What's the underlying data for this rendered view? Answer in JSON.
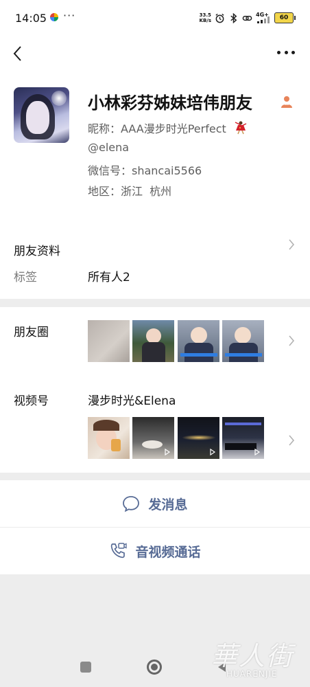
{
  "status_bar": {
    "time": "14:05",
    "more": "···",
    "speed_value": "33.5",
    "speed_unit": "KB/s",
    "network": "4G+",
    "battery": "60",
    "icons": [
      "pinwheel-icon",
      "alarm-icon",
      "bluetooth-icon",
      "link-icon",
      "signal-icon",
      "battery-icon"
    ]
  },
  "nav": {
    "back_icon": "chevron-left-icon",
    "more_icon": "more-dots-icon"
  },
  "profile": {
    "display_name": "小林彩芬姊妹培伟朋友",
    "nickname": "昵称：AAA漫步时光Perfect",
    "handle": "@elena",
    "wechat_id": "微信号：shancai5566",
    "region": "地区：浙江  杭州"
  },
  "friend_info": {
    "title": "朋友资料",
    "tag_label": "标签",
    "tag_value": "所有人2"
  },
  "moments": {
    "title": "朋友圈",
    "thumb_count_shown": 4
  },
  "channels": {
    "title": "视频号",
    "channel_name": "漫步时光&Elena",
    "thumb_count_shown": 4
  },
  "actions": {
    "send_message": "发消息",
    "av_call": "音视频通话"
  },
  "watermark": {
    "cn": "華人街",
    "en": "HUARENJIE"
  },
  "colors": {
    "link_blue": "#576b95",
    "background": "#ededed",
    "card": "#ffffff"
  }
}
